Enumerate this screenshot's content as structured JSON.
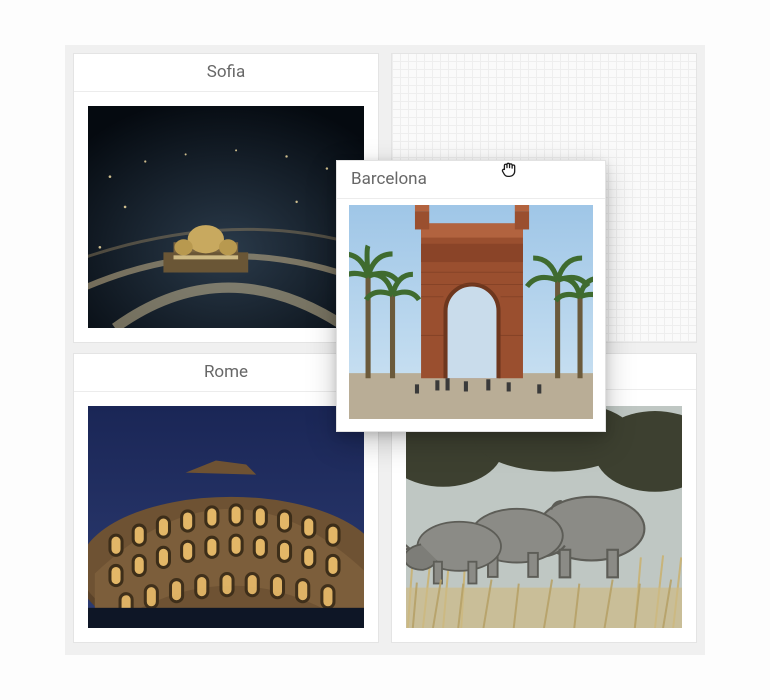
{
  "grid": {
    "slots": [
      {
        "id": "tl",
        "title": "Sofia",
        "image_desc": "night aerial view of Sofia with Alexander Nevsky Cathedral lit up"
      },
      {
        "id": "tr",
        "title": "",
        "image_desc": "",
        "placeholder": true
      },
      {
        "id": "bl",
        "title": "Rome",
        "image_desc": "Roman Colosseum at dusk against dark blue sky"
      },
      {
        "id": "br",
        "title": "",
        "image_desc": "three rhinoceroses standing in dry grass and brush"
      }
    ]
  },
  "dragged_card": {
    "title": "Barcelona",
    "image_desc": "Arc de Triomf of Barcelona with palm trees and people"
  },
  "cursor": {
    "name": "grab-cursor-icon"
  }
}
